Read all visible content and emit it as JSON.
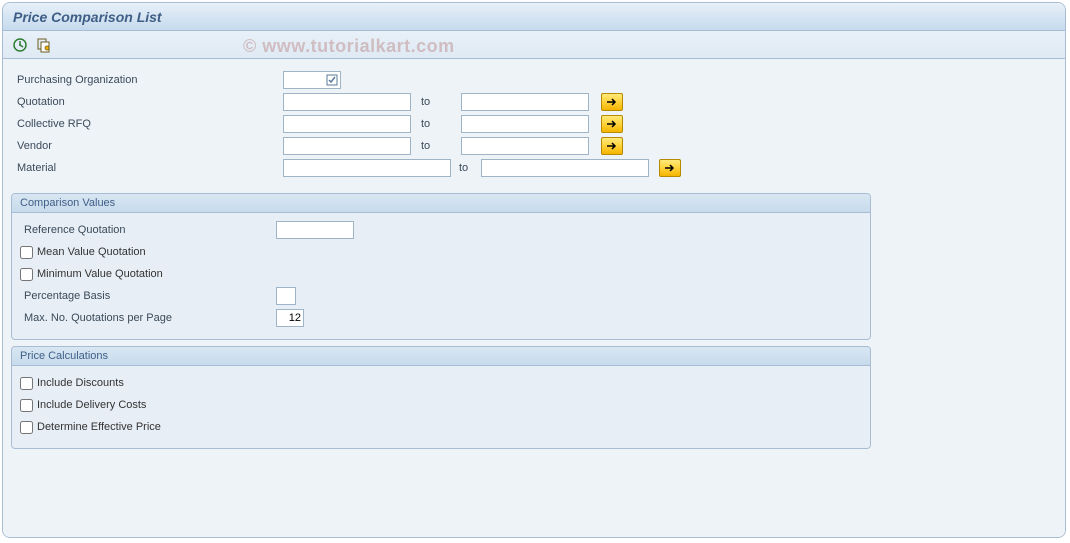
{
  "title": "Price Comparison List",
  "watermark": "© www.tutorialkart.com",
  "toolbar": {
    "execute": "Execute",
    "variant": "Get Variant"
  },
  "selection": {
    "purchasing_org": {
      "label": "Purchasing Organization",
      "value": ""
    },
    "to_label": "to",
    "quotation": {
      "label": "Quotation",
      "from": "",
      "to": ""
    },
    "collective_rfq": {
      "label": "Collective RFQ",
      "from": "",
      "to": ""
    },
    "vendor": {
      "label": "Vendor",
      "from": "",
      "to": ""
    },
    "material": {
      "label": "Material",
      "from": "",
      "to": ""
    }
  },
  "comparison": {
    "title": "Comparison Values",
    "reference_quotation": {
      "label": "Reference Quotation",
      "value": ""
    },
    "mean_value": {
      "label": "Mean Value Quotation",
      "checked": false
    },
    "minimum_value": {
      "label": "Minimum Value Quotation",
      "checked": false
    },
    "percentage_basis": {
      "label": "Percentage Basis",
      "value": ""
    },
    "max_quotations": {
      "label": "Max. No. Quotations per Page",
      "value": "12"
    }
  },
  "price_calc": {
    "title": "Price Calculations",
    "include_discounts": {
      "label": "Include Discounts",
      "checked": false
    },
    "include_delivery": {
      "label": "Include Delivery Costs",
      "checked": false
    },
    "determine_price": {
      "label": "Determine Effective Price",
      "checked": false
    }
  }
}
